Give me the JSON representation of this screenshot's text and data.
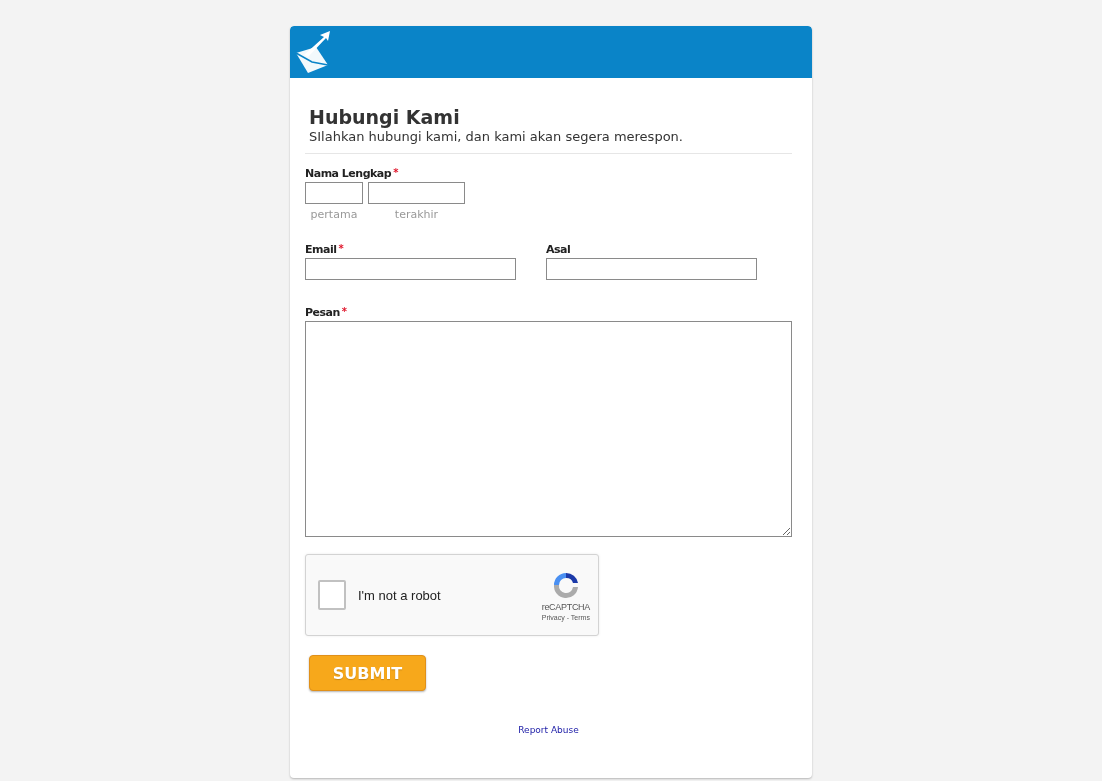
{
  "header": {
    "kind": "logo"
  },
  "form": {
    "title": "Hubungi Kami",
    "subtitle": "SIlahkan hubungi kami, dan kami akan segera merespon.",
    "name_field": {
      "label": "Nama Lengkap",
      "required_mark": "*",
      "parts": [
        {
          "caption": "pertama"
        },
        {
          "caption": "terakhir"
        }
      ]
    },
    "row_fields": [
      {
        "label": "Email",
        "required_mark": "*"
      },
      {
        "label": "Asal"
      }
    ],
    "message_field": {
      "label": "Pesan",
      "required_mark": "*"
    },
    "captcha": {
      "label": "I'm not a robot",
      "checked": false,
      "brand": "reCAPTCHA",
      "links": "Privacy - Terms"
    },
    "submit": "SUBMIT"
  },
  "footer": {
    "link": "Report Abuse"
  }
}
